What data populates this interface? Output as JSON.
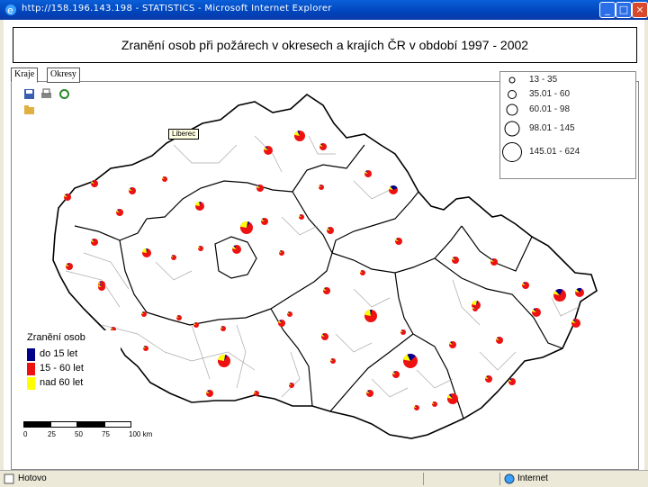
{
  "window": {
    "title": "http://158.196.143.198 - STATISTICS - Microsoft Internet Explorer"
  },
  "header": {
    "title": "Zranění osob při požárech v okresech a krajích ČR v období 1997 - 2002"
  },
  "tabs": [
    {
      "label": "Kraje"
    },
    {
      "label": "Okresy"
    }
  ],
  "toolbar": {
    "icons": [
      "save-icon",
      "print-icon",
      "refresh-icon",
      "export-icon"
    ]
  },
  "tooltip": {
    "text": "Liberec"
  },
  "size_legend": {
    "items": [
      {
        "label": "13 - 35"
      },
      {
        "label": "35.01 - 60"
      },
      {
        "label": "60.01 - 98"
      },
      {
        "label": "98.01 - 145"
      },
      {
        "label": "145.01 - 624"
      }
    ]
  },
  "color_legend": {
    "title": "Zranění osob",
    "items": [
      {
        "label": "do 15 let",
        "color": "#00008b"
      },
      {
        "label": "15 - 60 let",
        "color": "#ee1111"
      },
      {
        "label": "nad 60 let",
        "color": "#ffff00"
      }
    ]
  },
  "scale": {
    "ticks": [
      "0",
      "25",
      "50",
      "75",
      "100 km"
    ]
  },
  "status": {
    "left": "Hotovo",
    "right": "Internet"
  },
  "colors": {
    "pie_main": "#ee1111",
    "pie_child": "#00008b",
    "pie_senior": "#ffff00",
    "border": "#999999"
  }
}
